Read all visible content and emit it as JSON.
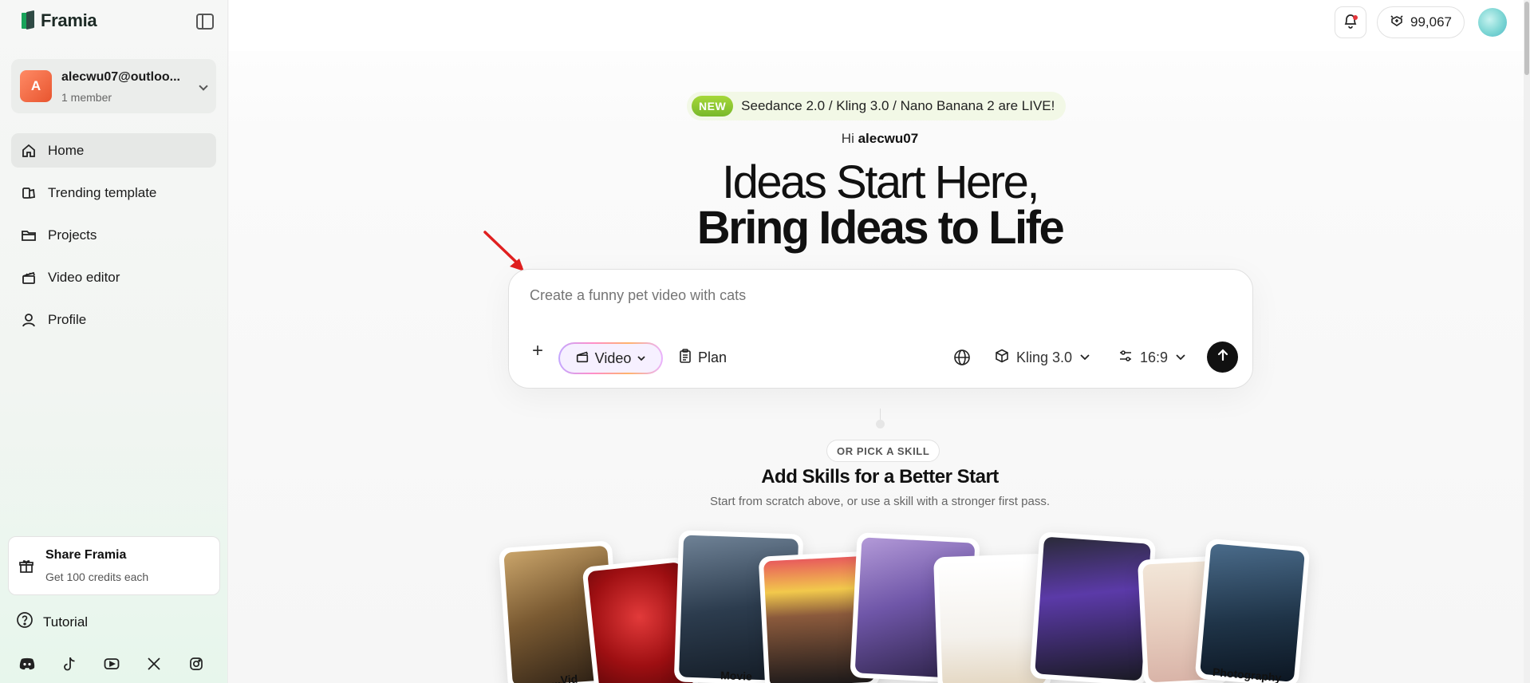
{
  "brand": {
    "name": "Framia"
  },
  "workspace": {
    "avatar_letter": "A",
    "name": "alecwu07@outloo...",
    "members": "1 member"
  },
  "nav": [
    {
      "label": "Home",
      "icon": "home-icon"
    },
    {
      "label": "Trending template",
      "icon": "template-icon"
    },
    {
      "label": "Projects",
      "icon": "folder-icon"
    },
    {
      "label": "Video editor",
      "icon": "clapper-icon"
    },
    {
      "label": "Profile",
      "icon": "user-icon"
    }
  ],
  "share": {
    "title": "Share Framia",
    "subtitle": "Get 100 credits each"
  },
  "tutorial": {
    "label": "Tutorial"
  },
  "socials": [
    "discord-icon",
    "tiktok-icon",
    "youtube-icon",
    "x-icon",
    "instagram-icon"
  ],
  "topbar": {
    "credits": "99,067"
  },
  "announcement": {
    "badge": "NEW",
    "text": "Seedance 2.0 / Kling 3.0 / Nano Banana 2 are LIVE!"
  },
  "greeting": {
    "prefix": "Hi",
    "username": "alecwu07"
  },
  "hero": {
    "line1": "Ideas Start Here,",
    "line2": "Bring Ideas to Life"
  },
  "composer": {
    "placeholder": "Create a funny pet video with cats",
    "mode": "Video",
    "plan": "Plan",
    "model": "Kling 3.0",
    "ratio": "16:9"
  },
  "skills": {
    "chip": "OR PICK A SKILL",
    "title": "Add Skills for a Better Start",
    "subtitle": "Start from scratch above, or use a skill with a stronger first pass.",
    "card_labels": [
      "...Vid",
      "Movie",
      "Photography"
    ]
  },
  "colors": {
    "accent": "#18a35a",
    "new_badge": "#8cc63f",
    "arrow": "#e02020"
  }
}
